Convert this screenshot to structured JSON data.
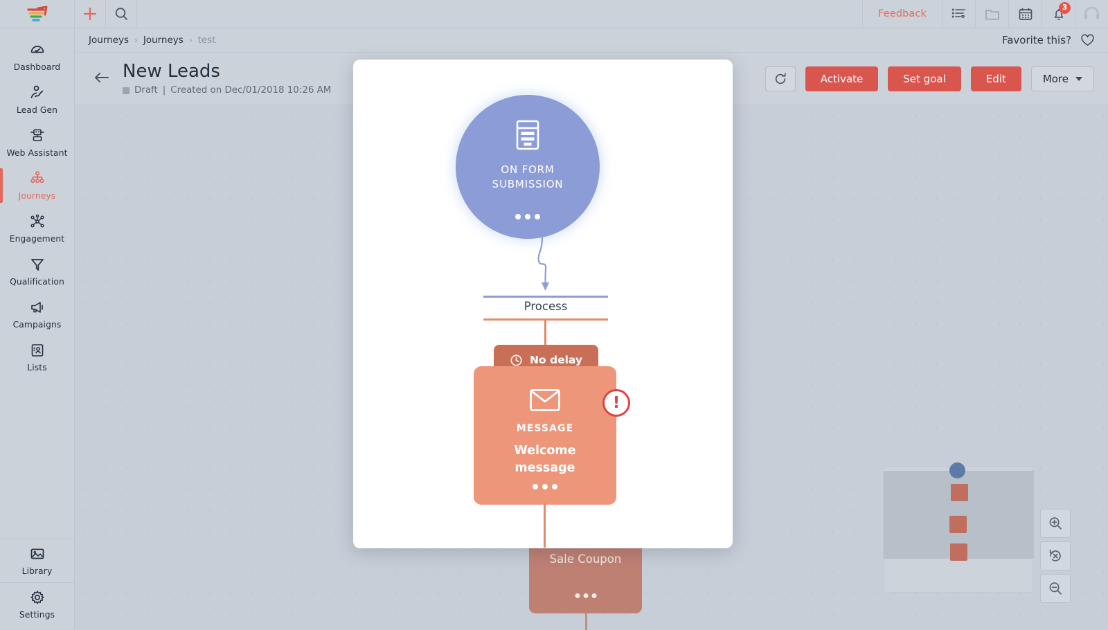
{
  "topbar": {
    "logo": "freshworks-logo",
    "add_label": "+",
    "search_label": "search-icon",
    "feedback_label": "Feedback",
    "icons": [
      {
        "name": "tasks-icon",
        "label": "Tasks"
      },
      {
        "name": "folder-icon",
        "label": "Files"
      },
      {
        "name": "calendar-icon",
        "label": "Calendar"
      },
      {
        "name": "bell-icon",
        "label": "Notifications",
        "badge": "3"
      },
      {
        "name": "support-headset-icon",
        "label": "Support"
      }
    ]
  },
  "sidebar": {
    "items": [
      {
        "label": "Dashboard",
        "icon": "dashboard-gauge-icon",
        "active": false
      },
      {
        "label": "Lead Gen",
        "icon": "lead-gen-person-icon",
        "active": false
      },
      {
        "label": "Web Assistant",
        "icon": "web-assistant-icon",
        "active": false
      },
      {
        "label": "Journeys",
        "icon": "journeys-tree-icon",
        "active": true
      },
      {
        "label": "Engagement",
        "icon": "engagement-network-icon",
        "active": false
      },
      {
        "label": "Qualification",
        "icon": "qualification-funnel-icon",
        "active": false
      },
      {
        "label": "Campaigns",
        "icon": "campaigns-megaphone-icon",
        "active": false
      },
      {
        "label": "Lists",
        "icon": "lists-contact-icon",
        "active": false
      }
    ],
    "bottom_items": [
      {
        "label": "Library",
        "icon": "library-image-icon",
        "active": false
      },
      {
        "label": "Settings",
        "icon": "settings-gear-icon",
        "active": false
      }
    ]
  },
  "breadcrumb": {
    "items": [
      "Journeys",
      "Journeys",
      "test"
    ],
    "separator": "›",
    "favorite_label": "Favorite this?"
  },
  "page_header": {
    "title": "New Leads",
    "status": "Draft",
    "meta_separator": "|",
    "created": "Created on Dec/01/2018 10:26 AM",
    "back_icon": "back-arrow-icon",
    "refresh_icon": "refresh-icon",
    "buttons": {
      "activate": "Activate",
      "set_goal": "Set goal",
      "edit": "Edit",
      "more": "More"
    }
  },
  "canvas": {
    "dimmed_node": {
      "name": "Sale Coupon"
    },
    "zoom_controls": [
      {
        "name": "zoom-in-icon",
        "label": "Zoom in"
      },
      {
        "name": "reset-zoom-icon",
        "label": "Reset zoom"
      },
      {
        "name": "zoom-out-icon",
        "label": "Zoom out"
      }
    ],
    "minimap": {
      "label": "minimap",
      "nodes": [
        {
          "type": "circle",
          "color": "#5e7ba8"
        },
        {
          "type": "square",
          "color": "#c06e5d"
        },
        {
          "type": "square",
          "color": "#c06e5d"
        },
        {
          "type": "square",
          "color": "#c06e5d"
        }
      ]
    }
  },
  "modal": {
    "trigger": {
      "icon": "form-document-icon",
      "label": "ON FORM SUBMISSION",
      "label_line1": "ON FORM",
      "label_line2": "SUBMISSION",
      "menu": "•••"
    },
    "process": {
      "label": "Process"
    },
    "delay": {
      "icon": "clock-icon",
      "label": "No delay"
    },
    "message": {
      "icon": "envelope-icon",
      "type_label": "MESSAGE",
      "name_line1": "Welcome",
      "name_line2": "message",
      "name": "Welcome message",
      "error_badge": "!",
      "menu": "•••"
    }
  },
  "colors": {
    "accent_red": "#d9564f",
    "feedback_red": "#e5695c",
    "trigger_blue": "#8c9cd6",
    "message_orange": "#ed9679",
    "delay_orange": "#c96f57",
    "canvas_bg": "#c7ced8",
    "chrome_bg": "#ccd2da",
    "error_red": "#e0453f"
  }
}
